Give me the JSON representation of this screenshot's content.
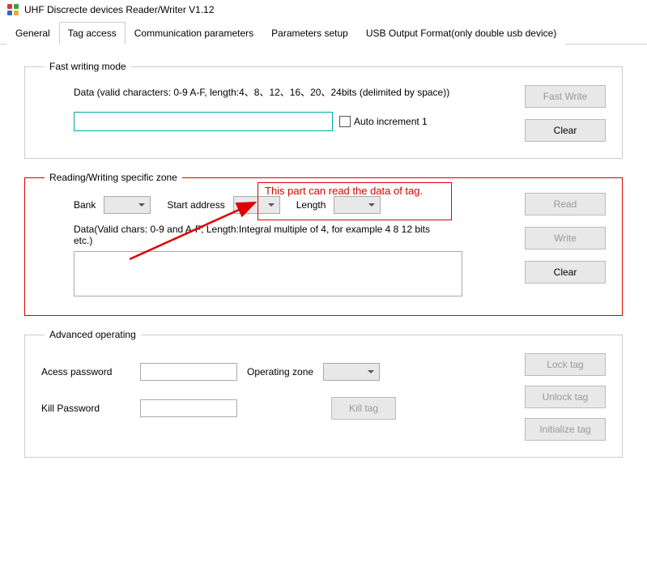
{
  "window": {
    "title": "UHF Discrecte devices Reader/Writer V1.12"
  },
  "tabs": {
    "general": "General",
    "tag_access": "Tag access",
    "comm_params": "Communication parameters",
    "params_setup": "Parameters setup",
    "usb_output": "USB Output Format(only double usb device)"
  },
  "fast_writing": {
    "legend": "Fast writing mode",
    "data_label": "Data (valid characters: 0-9 A-F, length:4、8、12、16、20、24bits (delimited by space))",
    "input_value": "",
    "auto_increment_label": "Auto increment 1",
    "fast_write_btn": "Fast Write",
    "clear_btn": "Clear"
  },
  "callout": {
    "text": "This part can read the data of tag."
  },
  "specific_zone": {
    "legend": "Reading/Writing specific zone",
    "bank_label": "Bank",
    "start_addr_label": "Start address",
    "length_label": "Length",
    "data_hint": "Data(Valid chars: 0-9 and A-F; Length:Integral multiple of 4, for example 4 8 12 bits etc.)",
    "read_btn": "Read",
    "write_btn": "Write",
    "clear_btn": "Clear"
  },
  "advanced": {
    "legend": "Advanced operating",
    "access_pw_label": "Acess password",
    "operating_zone_label": "Operating zone",
    "kill_pw_label": "Kill Password",
    "kill_tag_btn": "Kill tag",
    "lock_tag_btn": "Lock tag",
    "unlock_tag_btn": "Unlock tag",
    "init_tag_btn": "Initialize tag"
  }
}
